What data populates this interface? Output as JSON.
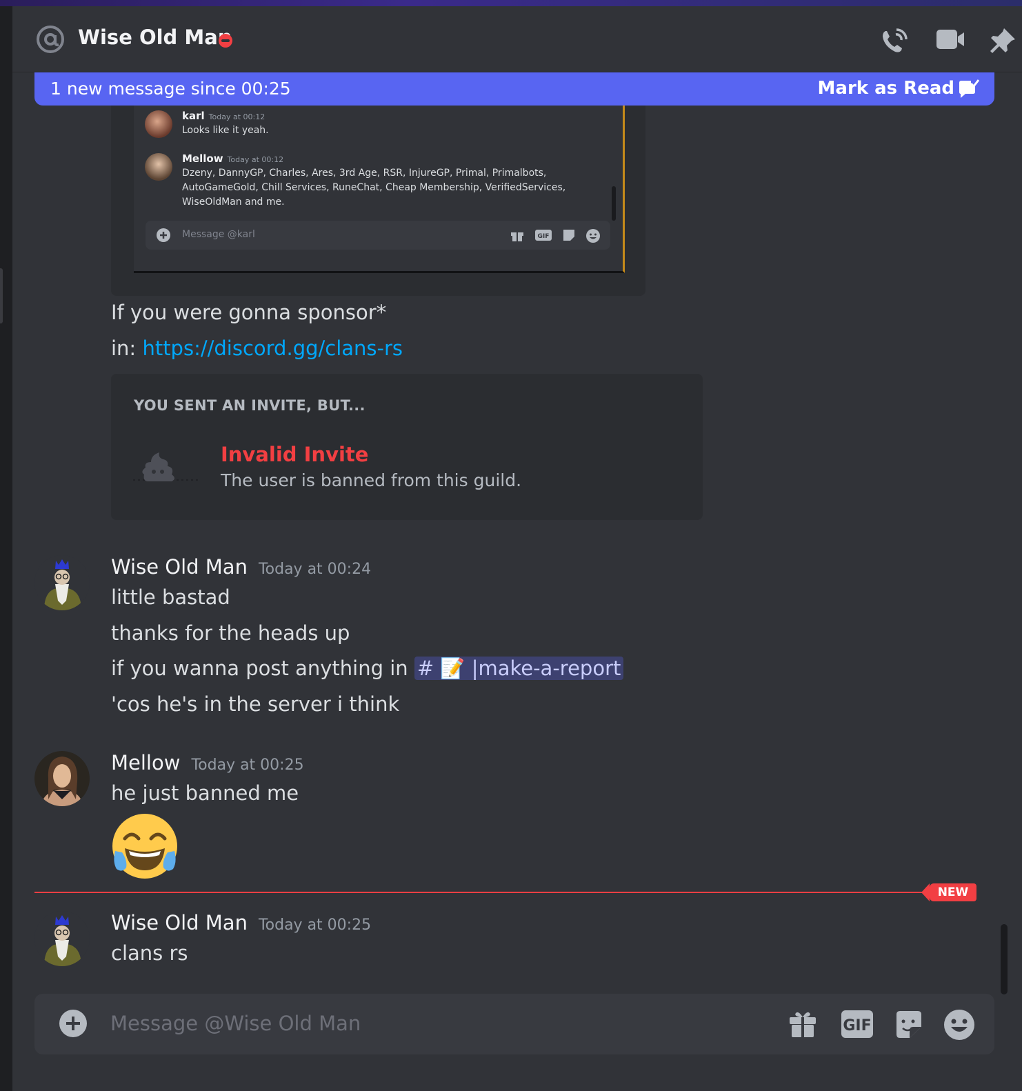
{
  "header": {
    "dm_name": "Wise Old Man",
    "status": "do-not-disturb",
    "icons": [
      "at-icon",
      "phone-call-icon",
      "video-call-icon",
      "pin-icon"
    ]
  },
  "new_bar": {
    "text": "1 new message since 00:25",
    "mark_read_label": "Mark as Read"
  },
  "embedded_screenshot": {
    "messages": [
      {
        "author": "karl",
        "timestamp": "Today at 00:12",
        "text": "Looks like it yeah."
      },
      {
        "author": "Mellow",
        "timestamp": "Today at 00:12",
        "lines": [
          "Dzeny, DannyGP, Charles, Ares, 3rd Age, RSR, InjureGP, Primal, Primalbots,",
          "AutoGameGold, Chill Services, RuneChat, Cheap Membership, VerifiedServices,",
          "WiseOldMan and me."
        ]
      }
    ],
    "input_placeholder": "Message @karl"
  },
  "messages_top": {
    "line1": "If you were gonna sponsor*",
    "line2_prefix": "in: ",
    "line2_link": "https://discord.gg/clans-rs"
  },
  "invite": {
    "heading": "YOU SENT AN INVITE, BUT...",
    "title": "Invalid Invite",
    "subtitle": "The user is banned from this guild."
  },
  "msg_group1": {
    "author": "Wise Old Man",
    "timestamp": "Today at 00:24",
    "lines": [
      "little bastad",
      "thanks for the heads up",
      "if you wanna post anything in",
      "'cos he's in the server i think"
    ],
    "channel_mention": "# 📝 |make-a-report"
  },
  "msg_group2": {
    "author": "Mellow",
    "timestamp": "Today at 00:25",
    "text": "he just banned me",
    "emoji": "😂"
  },
  "new_divider": {
    "label": "NEW"
  },
  "msg_group3": {
    "author": "Wise Old Man",
    "timestamp": "Today at 00:25",
    "text": "clans rs"
  },
  "composer": {
    "placeholder": "Message @Wise Old Man",
    "gif_label": "GIF"
  },
  "colors": {
    "background": "#313338",
    "accent": "#5865f2",
    "danger": "#f23f43",
    "link": "#00a8fc"
  }
}
